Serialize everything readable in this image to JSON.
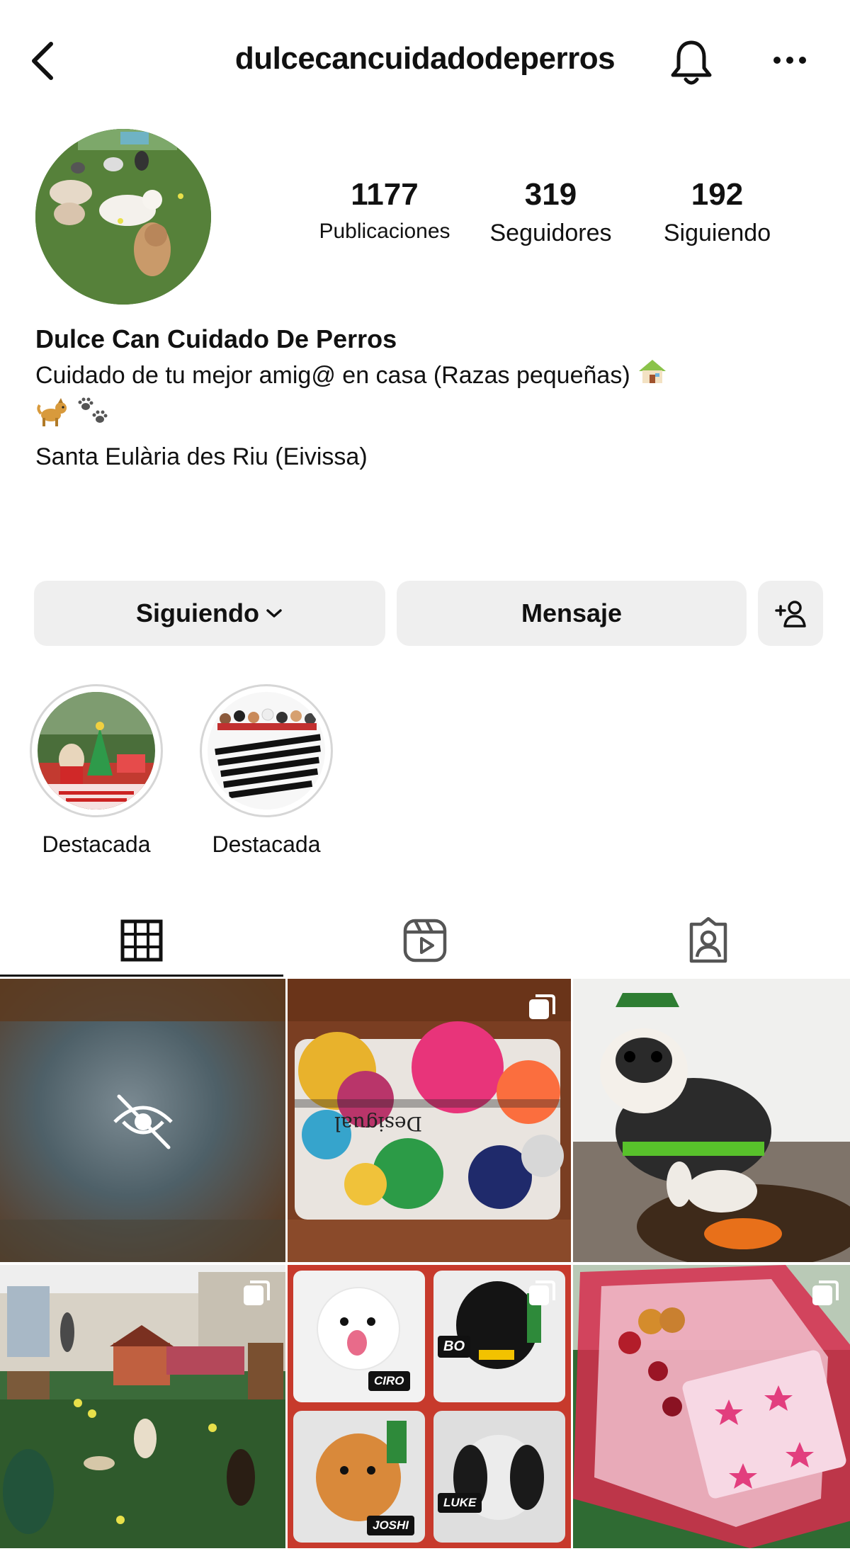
{
  "header": {
    "username": "dulcecancuidadodeperros"
  },
  "stats": {
    "posts": {
      "value": "1177",
      "label": "Publicaciones"
    },
    "followers": {
      "value": "319",
      "label": "Seguidores"
    },
    "following": {
      "value": "192",
      "label": "Siguiendo"
    }
  },
  "bio": {
    "name": "Dulce Can Cuidado De Perros",
    "description": "Cuidado de tu mejor amig@ en casa (Razas pequeñas)",
    "location": "Santa Eulària des Riu (Eivissa)"
  },
  "actions": {
    "following_label": "Siguiendo",
    "message_label": "Mensaje"
  },
  "highlights": [
    {
      "label": "Destacada"
    },
    {
      "label": "Destacada"
    }
  ],
  "tabs": [
    {
      "icon": "grid-icon",
      "active": true
    },
    {
      "icon": "reels-icon",
      "active": false
    },
    {
      "icon": "tagged-icon",
      "active": false
    }
  ],
  "posts": [
    {
      "type": "hidden",
      "multi": false
    },
    {
      "type": "photo",
      "multi": true
    },
    {
      "type": "photo",
      "multi": false
    },
    {
      "type": "photo",
      "multi": true
    },
    {
      "type": "photo",
      "multi": true
    },
    {
      "type": "photo",
      "multi": true
    }
  ],
  "post_tags": [
    "CIRO",
    "BO",
    "JOSHI",
    "LUKE"
  ],
  "colors": {
    "text": "#111111",
    "button_bg": "#efefef",
    "accent_green": "#4b7632"
  }
}
